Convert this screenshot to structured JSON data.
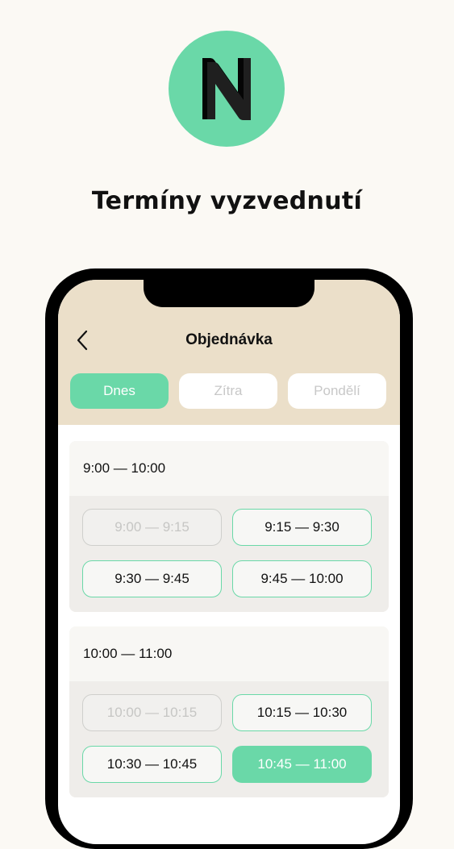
{
  "headline": "Termíny vyzvednutí",
  "logo": {
    "letter": "N",
    "color": "#6ad8a8"
  },
  "nav": {
    "title": "Objednávka",
    "back_icon": "chevron-left-icon"
  },
  "tabs": [
    {
      "label": "Dnes",
      "active": true
    },
    {
      "label": "Zítra",
      "active": false
    },
    {
      "label": "Pondělí",
      "active": false
    }
  ],
  "hour_groups": [
    {
      "label": "9:00 — 10:00",
      "slots": [
        {
          "label": "9:00 — 9:15",
          "state": "disabled"
        },
        {
          "label": "9:15 — 9:30",
          "state": "available"
        },
        {
          "label": "9:30 — 9:45",
          "state": "available"
        },
        {
          "label": "9:45 — 10:00",
          "state": "available"
        }
      ]
    },
    {
      "label": "10:00 — 11:00",
      "slots": [
        {
          "label": "10:00 — 10:15",
          "state": "disabled"
        },
        {
          "label": "10:15 — 10:30",
          "state": "available"
        },
        {
          "label": "10:30 — 10:45",
          "state": "available"
        },
        {
          "label": "10:45 — 11:00",
          "state": "selected"
        }
      ]
    }
  ],
  "colors": {
    "accent": "#6ad8a8",
    "header_bg": "#ebdfc9",
    "page_bg": "#fbf9f4"
  }
}
